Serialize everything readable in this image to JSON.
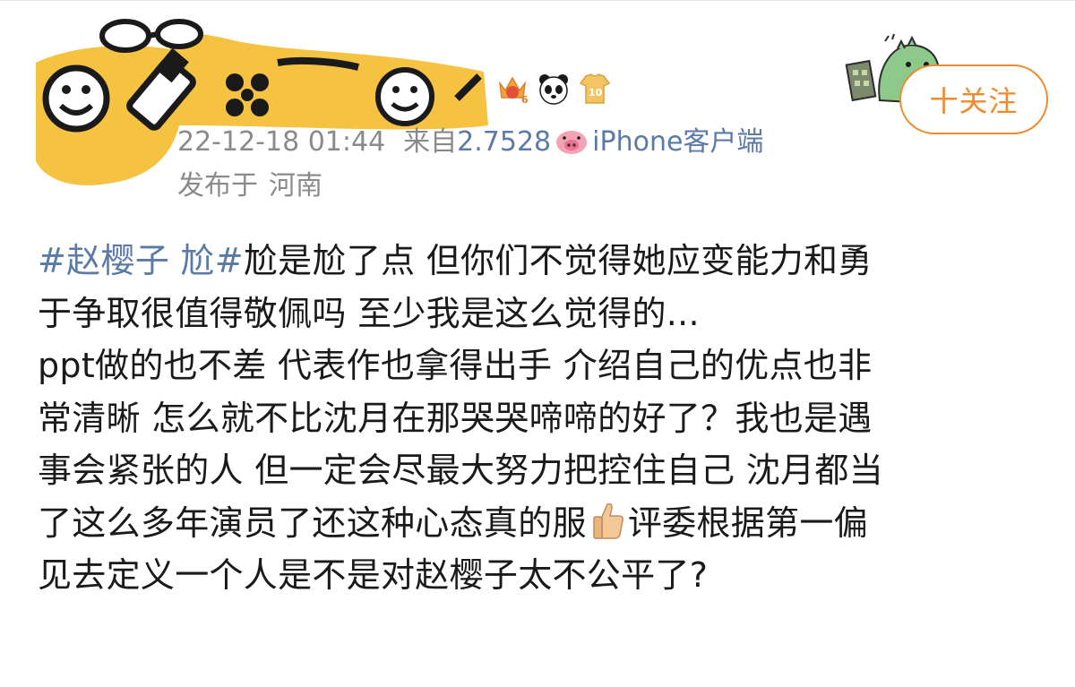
{
  "post": {
    "timestamp": "22-12-18 01:44",
    "source_prefix": "来自",
    "source_name_a": "2.7528",
    "source_name_b": "iPhone客户端",
    "location_prefix": "发布于",
    "location": "河南",
    "follow_label": "十关注",
    "hashtag": "#赵樱子 尬#",
    "lines": [
      "尬是尬了点 但你们不觉得她应变能力和勇",
      "于争取很值得敬佩吗 至少我是这么觉得的...",
      "ppt做的也不差 代表作也拿得出手 介绍自己的优点也非",
      "常清晰 怎么就不比沈月在那哭哭啼啼的好了？我也是遇",
      "事会紧张的人 但一定会尽最大努力把控住自己 沈月都当",
      "了这么多年演员了还这种心态真的服",
      "评委根据第一偏",
      "见去定义一个人是不是对赵樱子太不公平了?"
    ],
    "badges": [
      "crown-badge",
      "panda-badge",
      "jersey-badge"
    ],
    "badge_numbers": [
      "6",
      "10"
    ],
    "emoji": "thumbs-up-emoji"
  },
  "colors": {
    "link": "#5b7aa6",
    "meta": "#8a8a8a",
    "follow": "#f08a2c",
    "censor": "#f5c242"
  }
}
